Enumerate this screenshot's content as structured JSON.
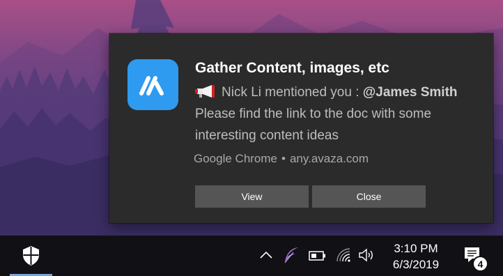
{
  "notification": {
    "title": "Gather Content, images, etc",
    "sender_text": "Nick Li mentioned you : ",
    "mention": "@James Smith",
    "message": " Please find the link to the doc with some interesting content ideas",
    "source_app": "Google Chrome",
    "separator": "•",
    "source_url": "any.avaza.com",
    "app_icon": "avaza-logo-icon",
    "emoji_icon": "megaphone-icon",
    "buttons": {
      "view": "View",
      "close": "Close"
    }
  },
  "taskbar": {
    "time": "3:10 PM",
    "date": "6/3/2019",
    "notification_count": "4",
    "icons": [
      "shield-icon",
      "chevron-up-icon",
      "feather-icon",
      "battery-icon",
      "wifi-icon",
      "volume-icon",
      "action-center-icon"
    ]
  },
  "colors": {
    "toast_bg": "#2b2b2b",
    "button_bg": "#555555",
    "app_icon_bg": "#2e9bf0",
    "taskbar_bg": "#111014"
  }
}
